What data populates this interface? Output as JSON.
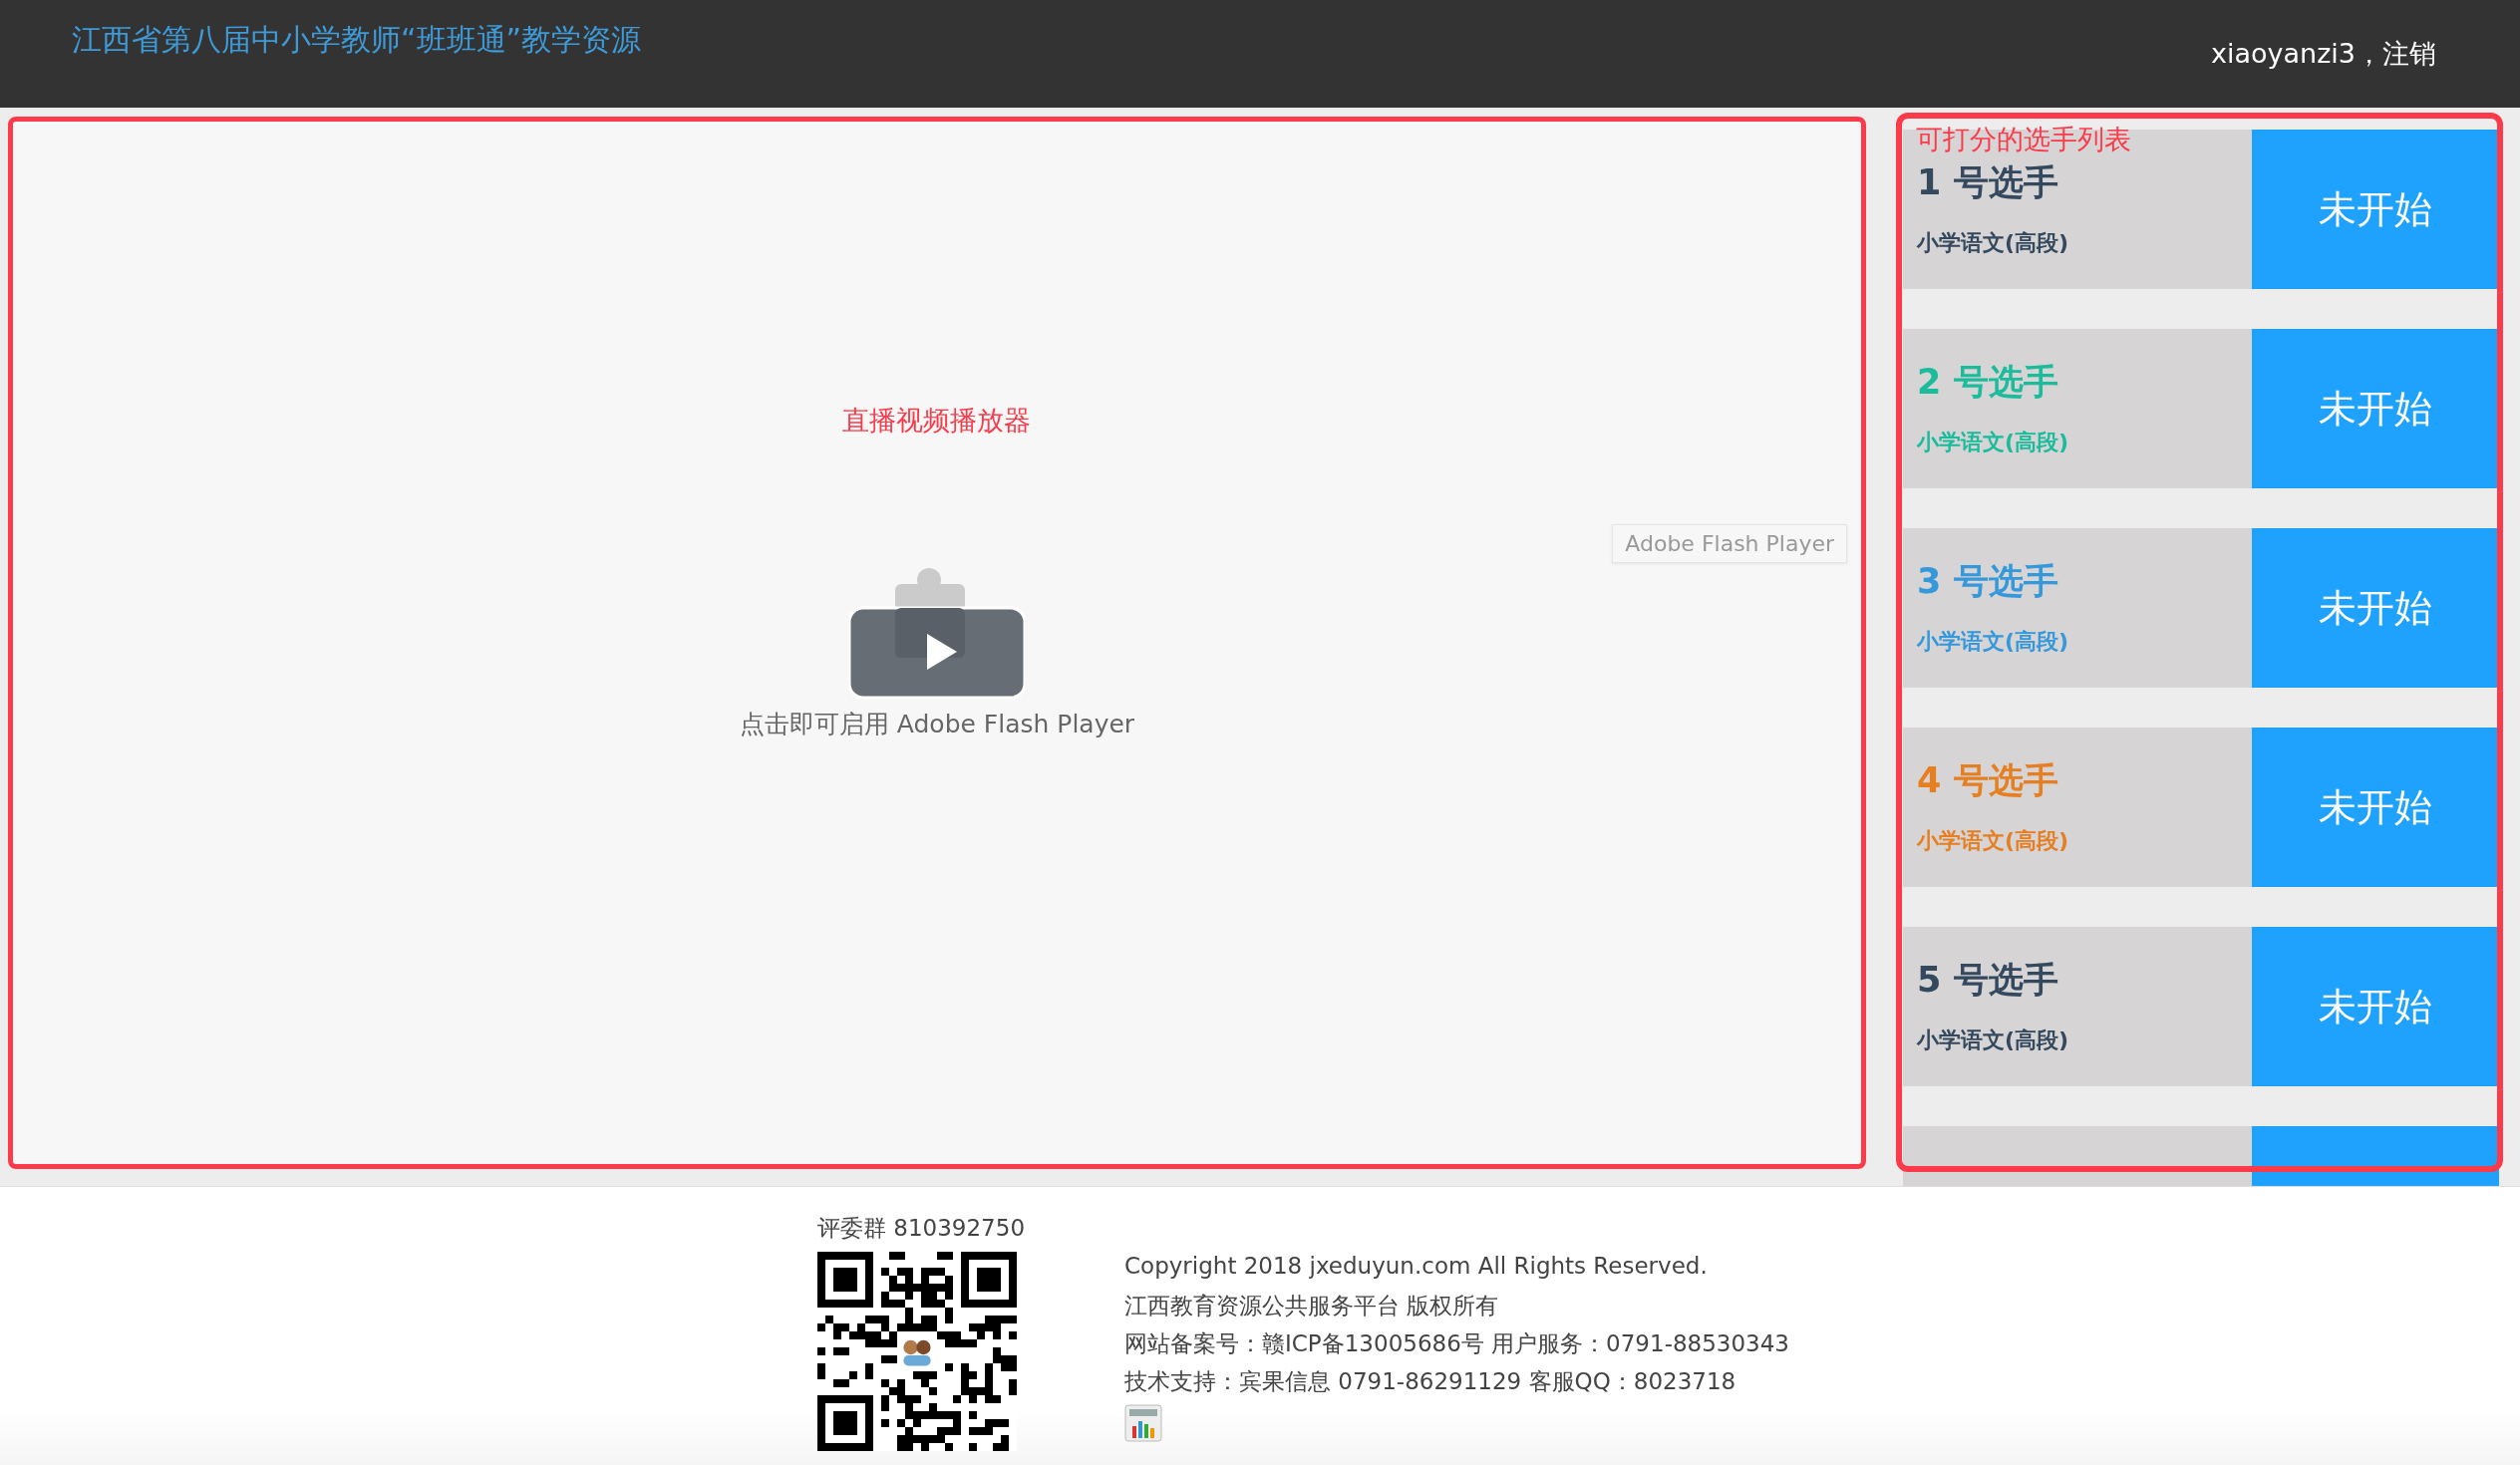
{
  "header": {
    "title": "江西省第八届中小学教师“班班通”教学资源",
    "user": "xiaoyanzi3，注销"
  },
  "player": {
    "label": "直播视频播放器",
    "tooltip": "Adobe Flash Player",
    "prompt": "点击即可启用 Adobe Flash Player"
  },
  "contestants": {
    "heading": "可打分的选手列表",
    "items": [
      {
        "name": "1 号选手",
        "subject": "小学语文(高段)",
        "color": "#34495e",
        "status": "未开始"
      },
      {
        "name": "2 号选手",
        "subject": "小学语文(高段)",
        "color": "#1abc9c",
        "status": "未开始"
      },
      {
        "name": "3 号选手",
        "subject": "小学语文(高段)",
        "color": "#3498db",
        "status": "未开始"
      },
      {
        "name": "4 号选手",
        "subject": "小学语文(高段)",
        "color": "#e67e22",
        "status": "未开始"
      },
      {
        "name": "5 号选手",
        "subject": "小学语文(高段)",
        "color": "#34495e",
        "status": "未开始"
      }
    ]
  },
  "footer": {
    "group": "评委群 810392750",
    "lines": [
      "Copyright 2018 jxeduyun.com All Rights Reserved.",
      "江西教育资源公共服务平台 版权所有",
      "网站备案号：赣ICP备13005686号 用户服务：0791-88530343",
      "技术支持：宾果信息 0791-86291129 客服QQ：8023718"
    ]
  }
}
